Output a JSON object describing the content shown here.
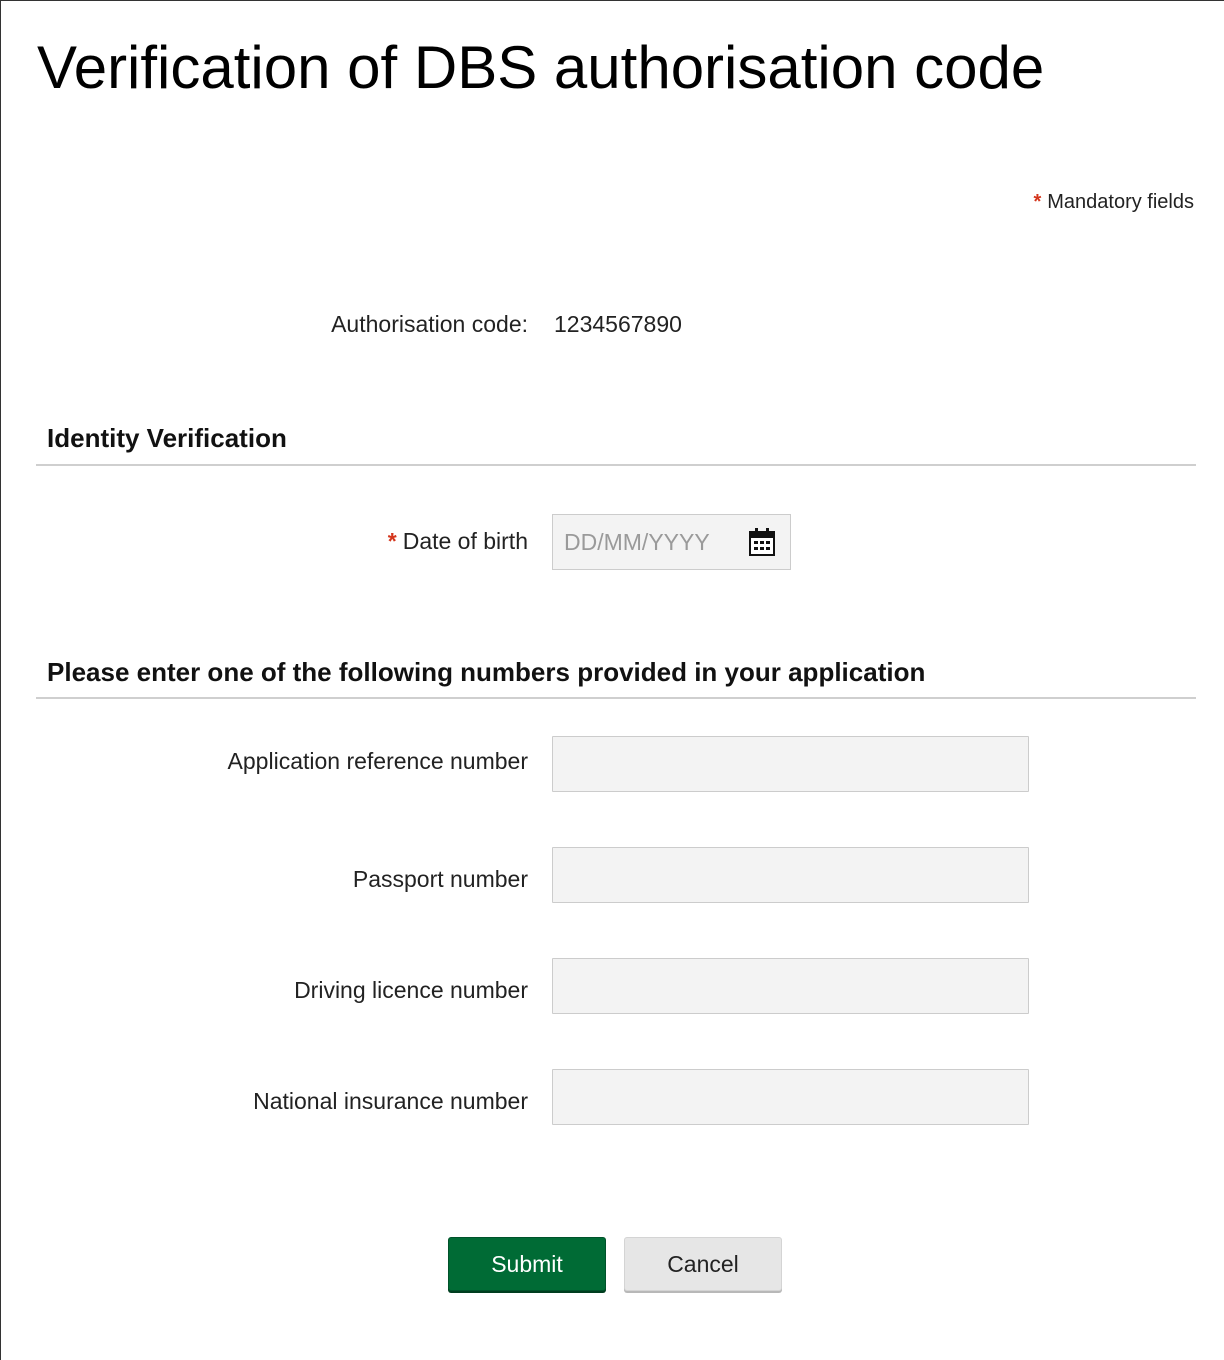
{
  "page": {
    "title": "Verification of DBS authorisation code"
  },
  "mandatory_note": {
    "star": "*",
    "text": "Mandatory fields"
  },
  "authorisation": {
    "label": "Authorisation code:",
    "value": "1234567890"
  },
  "identity_section": {
    "heading": "Identity Verification",
    "date_of_birth": {
      "required_marker": "*",
      "label": "Date of birth",
      "placeholder": "DD/MM/YYYY",
      "value": "",
      "icon": "calendar-icon"
    }
  },
  "numbers_section": {
    "heading": "Please enter one of the following numbers provided in your application",
    "fields": [
      {
        "label": "Application reference number",
        "value": ""
      },
      {
        "label": "Passport number",
        "value": ""
      },
      {
        "label": "Driving licence number",
        "value": ""
      },
      {
        "label": "National insurance number",
        "value": ""
      }
    ]
  },
  "actions": {
    "submit_label": "Submit",
    "cancel_label": "Cancel"
  },
  "colors": {
    "primary_button": "#006b35",
    "required_marker": "#d4351c",
    "input_background": "#f3f3f3"
  }
}
